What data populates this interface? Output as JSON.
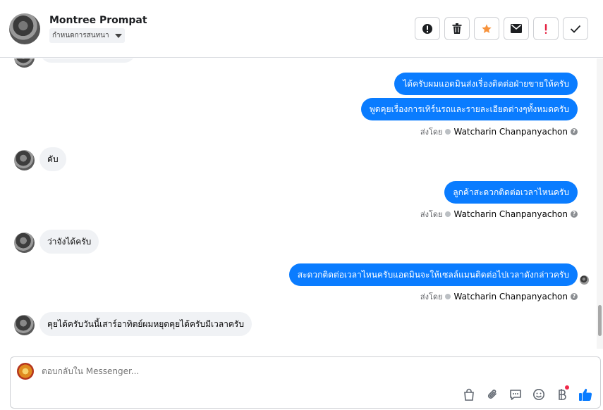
{
  "header": {
    "contact_name": "Montree Prompat",
    "nickname_select": "กำหนดการสนทนา",
    "actions": {
      "spam": "spam-icon",
      "delete": "trash-icon",
      "star": "star-icon",
      "mark_unread": "envelope-icon",
      "follow_up": "exclamation-icon",
      "done": "check-icon"
    }
  },
  "messages": [
    {
      "direction": "out",
      "text": "ได้ครับผมแอดมินส่งเรื่องติดต่อฝ่ายขายให้ครับ"
    },
    {
      "direction": "out",
      "text": "พูดคุยเรื่องการเทิร์นรถและรายละเอียดต่างๆทั้งหมดครับ"
    },
    {
      "direction": "meta",
      "prefix": "ส่งโดย",
      "sender": "Watcharin Chanpanyachon"
    },
    {
      "direction": "in",
      "text": "คับ"
    },
    {
      "direction": "out",
      "text": "ลูกค้าสะดวกติดต่อเวลาไหนครับ"
    },
    {
      "direction": "meta",
      "prefix": "ส่งโดย",
      "sender": "Watcharin Chanpanyachon"
    },
    {
      "direction": "in",
      "text": "ว่าจังได้ครับ"
    },
    {
      "direction": "out",
      "text": "สะดวกติดต่อเวลาไหนครับแอดมินจะให้เซลล์แมนติดต่อไปเวลาดังกล่าวครับ"
    },
    {
      "direction": "meta",
      "prefix": "ส่งโดย",
      "sender": "Watcharin Chanpanyachon"
    },
    {
      "direction": "in",
      "text": "คุยได้ครับวันนี้เสาร์อาทิตย์ผมหยุดคุยได้ครับมีเวลาครับ"
    }
  ],
  "composer": {
    "placeholder": "ตอบกลับใน Messenger...",
    "tools": [
      "shopping-bag-icon",
      "paperclip-icon",
      "saved-replies-icon",
      "emoji-icon",
      "baht-payment-icon",
      "thumbs-up-icon"
    ]
  },
  "colors": {
    "outgoing_bubble": "#0a7cff",
    "incoming_bubble": "#f0f2f5",
    "star": "#f7923b",
    "follow_up": "#e41e3f",
    "like": "#0a7cff"
  }
}
